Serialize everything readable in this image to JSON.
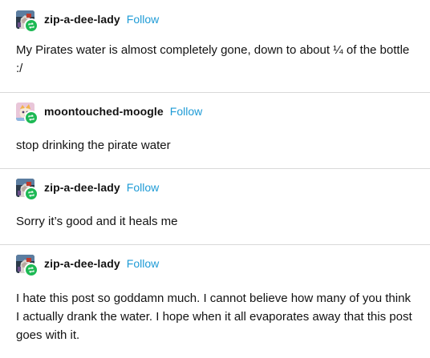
{
  "posts": [
    {
      "username": "zip-a-dee-lady",
      "follow_label": "Follow",
      "text": "My Pirates water is almost completely gone, down to about ¼ of the bottle :/",
      "avatar_icon": "pirate-avatar-icon"
    },
    {
      "username": "moontouched-moogle",
      "follow_label": "Follow",
      "text": "stop drinking the pirate water",
      "avatar_icon": "moogle-avatar-icon"
    },
    {
      "username": "zip-a-dee-lady",
      "follow_label": "Follow",
      "text": "Sorry it’s good and it heals me",
      "avatar_icon": "pirate-avatar-icon"
    },
    {
      "username": "zip-a-dee-lady",
      "follow_label": "Follow",
      "text": "I hate this post so goddamn much. I cannot believe how many of you think I actually drank the water. I hope when it all evaporates away that this post goes with it.",
      "avatar_icon": "pirate-avatar-icon"
    }
  ],
  "colors": {
    "follow": "#1e9bd6",
    "reblog_badge": "#1db954",
    "divider": "#d9d9d9",
    "text": "#121212"
  }
}
